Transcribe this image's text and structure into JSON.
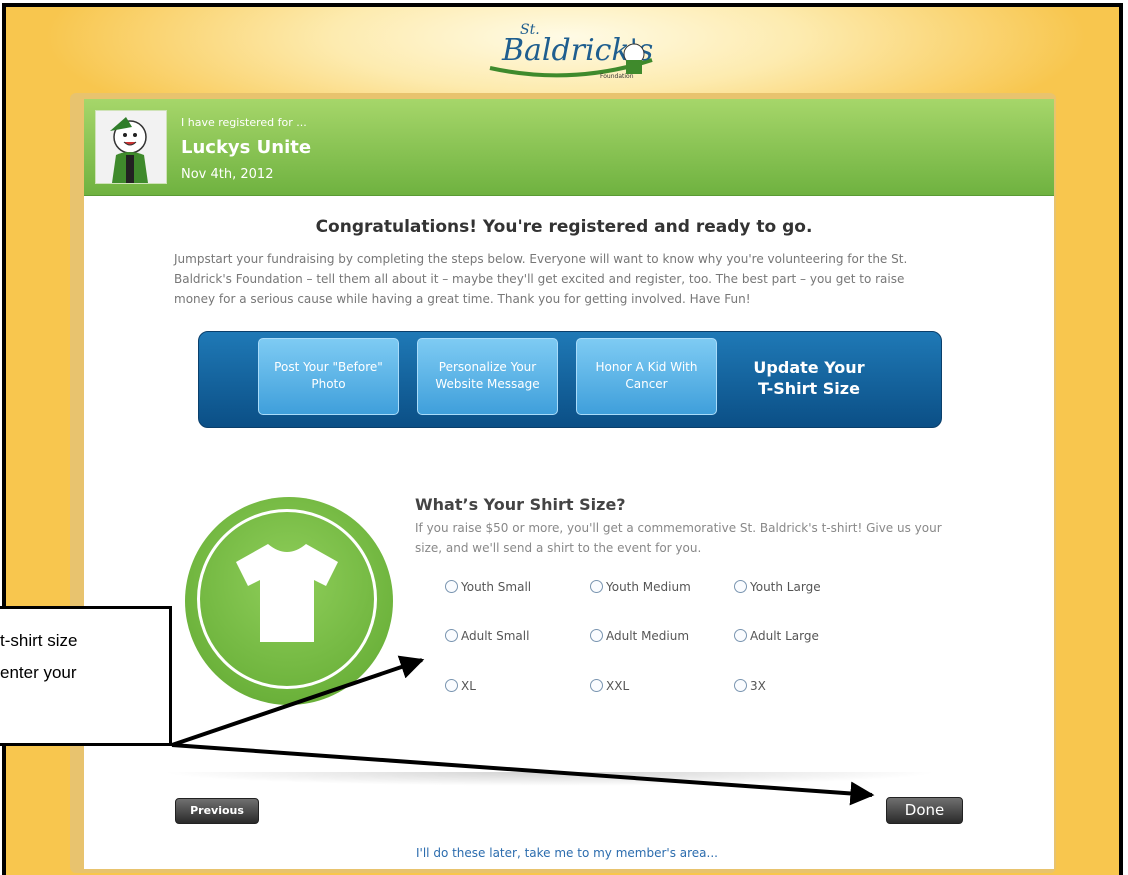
{
  "logo": {
    "name": "St. Baldrick's",
    "subtitle": "Foundation"
  },
  "header": {
    "registered_label": "I have registered for ...",
    "event_title": "Luckys Unite",
    "event_date": "Nov 4th, 2012"
  },
  "main": {
    "congrats_title": "Congratulations! You're registered and ready to go.",
    "intro_text": "Jumpstart your fundraising by completing the steps below. Everyone will want to know why you're volunteering for the St. Baldrick's Foundation – tell them all about it – maybe they'll get excited and register, too. The best part – you get to raise money for a serious cause while having a great time. Thank you for getting involved. Have Fun!"
  },
  "steps": [
    {
      "label": "Post Your \"Before\" Photo"
    },
    {
      "label": "Personalize Your Website Message"
    },
    {
      "label": "Honor A Kid With Cancer"
    }
  ],
  "active_step": {
    "line1": "Update Your",
    "line2": "T-Shirt Size"
  },
  "shirt": {
    "question": "What’s Your Shirt Size?",
    "description": "If you raise $50 or more, you'll get a commemorative St. Baldrick's t-shirt! Give us your size, and we'll send a shirt to the event for you.",
    "options": [
      "Youth Small",
      "Youth Medium",
      "Youth Large",
      "Adult Small",
      "Adult Medium",
      "Adult Large",
      "XL",
      "XXL",
      "3X"
    ]
  },
  "buttons": {
    "previous": "Previous",
    "done": "Done"
  },
  "later_link": "I'll do these later, take me to my member's area...",
  "callout": {
    "line1": "t-shirt size",
    "line2": "enter your"
  },
  "colors": {
    "header_green": "#6fb240",
    "step_blue": "#1f79b6",
    "background_yellow": "#f8c64e",
    "link_blue": "#2b6cae"
  }
}
